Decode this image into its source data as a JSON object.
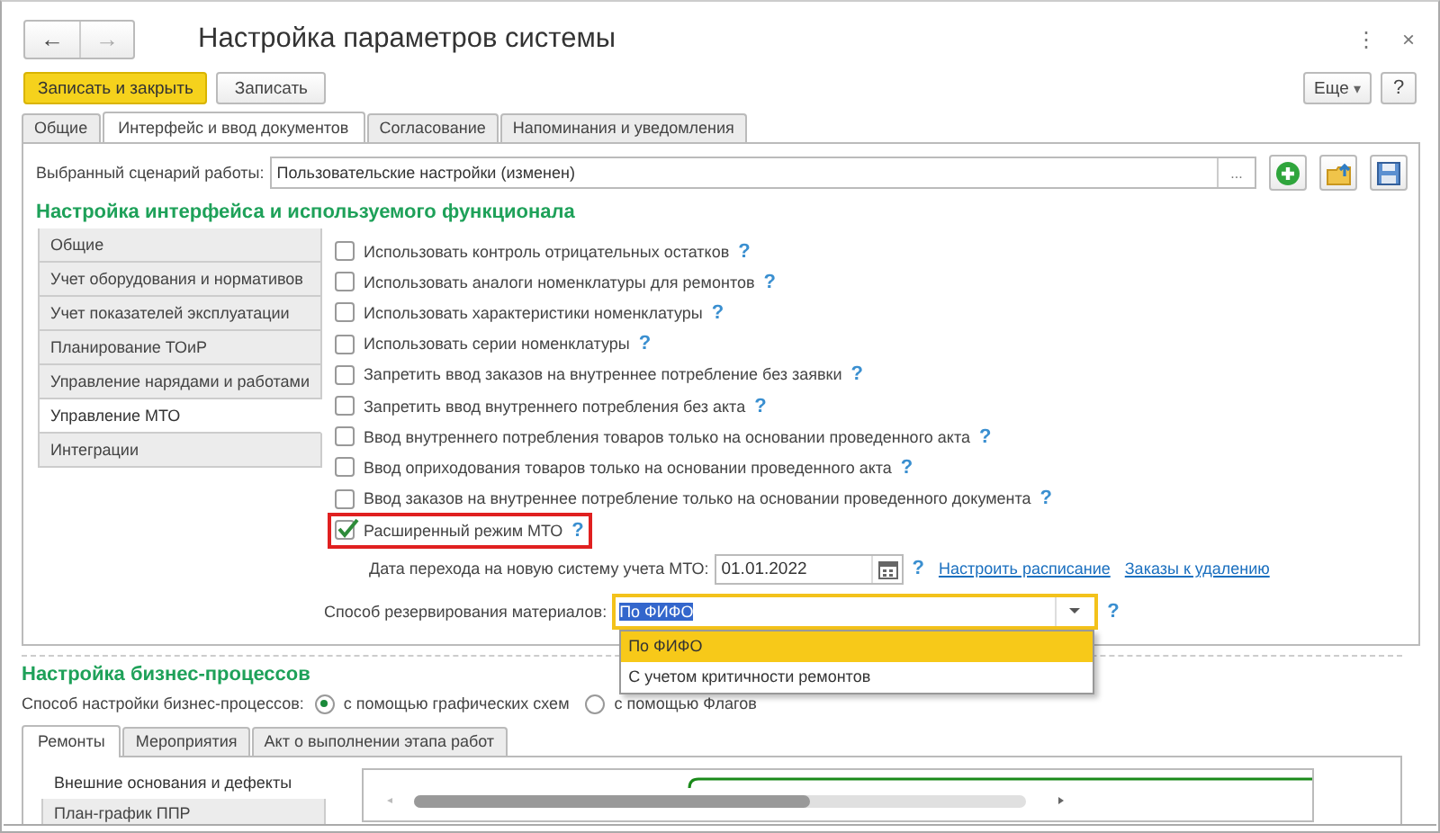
{
  "window": {
    "title": "Настройка параметров системы",
    "controls": [
      "⋮",
      "×"
    ]
  },
  "nav_buttons": [
    {
      "symbol": "←",
      "disabled": false
    },
    {
      "symbol": "→",
      "disabled": true
    }
  ],
  "toolbar": {
    "buttons": [
      {
        "label": "Записать и закрыть",
        "kind": "primary"
      },
      {
        "label": "Записать",
        "kind": "default"
      }
    ],
    "more": "Еще",
    "more_caret": "▾",
    "help": "?"
  },
  "tabs": [
    {
      "label": "Общие",
      "selected": false
    },
    {
      "label": "Интерфейс и ввод документов",
      "selected": true
    },
    {
      "label": "Согласование",
      "selected": false
    },
    {
      "label": "Напоминания и уведомления",
      "selected": false
    }
  ],
  "scenario": {
    "label": "Выбранный сценарий работы:",
    "value": "Пользовательские настройки (изменен)",
    "select_button": "..."
  },
  "interface_section": {
    "title": "Настройка интерфейса и используемого функционала",
    "sidebar": [
      {
        "label": "Общие",
        "selected": false
      },
      {
        "label": "Учет оборудования и нормативов",
        "selected": false
      },
      {
        "label": "Учет показателей эксплуатации",
        "selected": false
      },
      {
        "label": "Планирование ТОиР",
        "selected": false
      },
      {
        "label": "Управление нарядами и работами",
        "selected": false
      },
      {
        "label": "Управление МТО",
        "selected": true
      },
      {
        "label": "Интеграции",
        "selected": false
      }
    ],
    "options": [
      {
        "label": "Использовать контроль отрицательных остатков",
        "help": "?",
        "checked": false,
        "highlighted": false
      },
      {
        "label": "Использовать аналоги номенклатуры для ремонтов",
        "help": "?",
        "checked": false,
        "highlighted": false
      },
      {
        "label": "Использовать характеристики номенклатуры",
        "help": "?",
        "checked": false,
        "highlighted": false
      },
      {
        "label": "Использовать серии номенклатуры",
        "help": "?",
        "checked": false,
        "highlighted": false
      },
      {
        "label": "Запретить ввод заказов на внутреннее потребление без заявки",
        "help": "?",
        "checked": false,
        "highlighted": false
      },
      {
        "label": "Запретить ввод внутреннего потребления без акта",
        "help": "?",
        "checked": false,
        "highlighted": false
      },
      {
        "label": "Ввод внутреннего потребления товаров только на основании проведенного акта",
        "help": "?",
        "checked": false,
        "highlighted": false
      },
      {
        "label": "Ввод оприходования товаров только на основании проведенного акта",
        "help": "?",
        "checked": false,
        "highlighted": false
      },
      {
        "label": "Ввод заказов на внутреннее потребление только на основании проведенного документа",
        "help": "?",
        "checked": false,
        "highlighted": false
      },
      {
        "label": "Расширенный режим МТО",
        "help": "?",
        "checked": true,
        "highlighted": true
      }
    ],
    "date_field": {
      "label": "Дата перехода на новую систему учета МТО:",
      "value": "01.01.2022",
      "help": "?"
    },
    "links": [
      "Настроить расписание",
      "Заказы к удалению"
    ],
    "reservation": {
      "label": "Способ резервирования материалов:",
      "value": "По ФИФО",
      "help": "?",
      "expanded": true,
      "options": [
        {
          "label": "По ФИФО",
          "selected": true
        },
        {
          "label": "С учетом критичности ремонтов",
          "selected": false
        }
      ]
    }
  },
  "business_section": {
    "title": "Настройка бизнес-процессов",
    "mode_label": "Способ настройки бизнес-процессов:",
    "modes": [
      {
        "label": "с помощью графических схем",
        "selected": true
      },
      {
        "label": "с помощью Флагов",
        "selected": false
      }
    ],
    "tabs": [
      {
        "label": "Ремонты",
        "selected": true
      },
      {
        "label": "Мероприятия",
        "selected": false
      },
      {
        "label": "Акт о выполнении этапа работ",
        "selected": false
      }
    ],
    "sidebar": [
      {
        "label": "Внешние основания и дефекты",
        "selected": true
      },
      {
        "label": "План-график ППР",
        "selected": false
      }
    ]
  }
}
